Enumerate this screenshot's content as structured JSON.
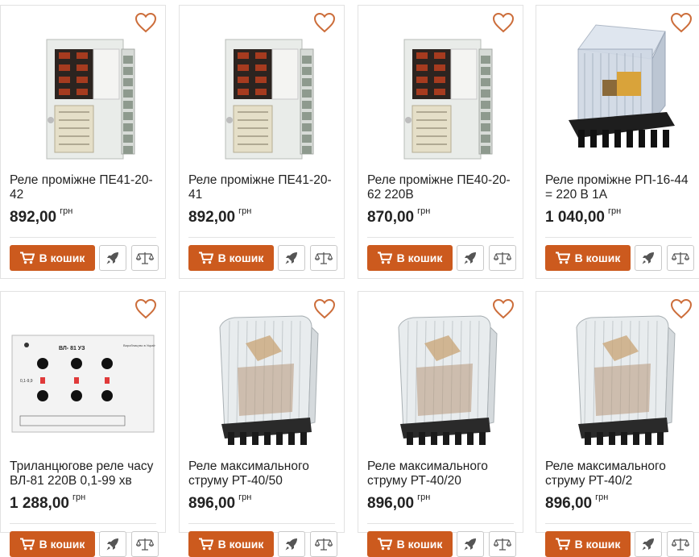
{
  "currency": "грн",
  "cart_label": "В кошик",
  "accent_color": "#cc5a1e",
  "products": [
    {
      "title": "Реле проміжне ПЕ41-20-42",
      "price": "892,00",
      "image": "relay-pe-module"
    },
    {
      "title": "Реле проміжне ПЕ41-20-41",
      "price": "892,00",
      "image": "relay-pe-module"
    },
    {
      "title": "Реле проміжне ПЕ40-20-62 220В",
      "price": "870,00",
      "image": "relay-pe-module"
    },
    {
      "title": "Реле проміжне РП-16-44 = 220 В 1А",
      "price": "1 040,00",
      "image": "relay-rp-clear"
    },
    {
      "title": "Триланцюгове реле часу ВЛ-81 220В 0,1-99 хв",
      "price": "1 288,00",
      "image": "timer-vl81"
    },
    {
      "title": "Реле максимального струму РТ-40/50",
      "price": "896,00",
      "image": "relay-rt40"
    },
    {
      "title": "Реле максимального струму РТ-40/20",
      "price": "896,00",
      "image": "relay-rt40"
    },
    {
      "title": "Реле максимального струму РТ-40/2",
      "price": "896,00",
      "image": "relay-rt40"
    }
  ],
  "image_labels": {
    "timer_model": "ВЛ- 81 УЗ",
    "timer_range": "0,1-9,9",
    "timer_maker": "Виробництво в Україні"
  }
}
